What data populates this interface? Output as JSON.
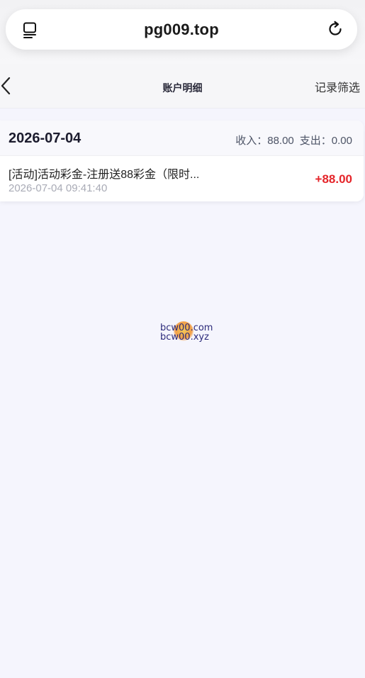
{
  "browser": {
    "url": "pg009.top",
    "icons": {
      "tabs": "tabs-icon",
      "reload": "reload-icon"
    }
  },
  "nav": {
    "back_icon": "chevron-left-icon",
    "title": "账户明细",
    "filter_label": "记录筛选"
  },
  "records": [
    {
      "date": "2026-07-04",
      "income_label": "收入：",
      "income_value": "88.00",
      "expense_label": "支出：",
      "expense_value": "0.00",
      "items": [
        {
          "title": "[活动]活动彩金-注册送88彩金（限时...",
          "time": "2026-07-04 09:41:40",
          "amount": "+88.00"
        }
      ]
    }
  ],
  "watermark": {
    "line1": "bcw00.com",
    "line2": "bcw00.xyz"
  },
  "colors": {
    "background": "#f5f5fd",
    "amount_positive": "#e5252a",
    "muted_text": "#a9abb6"
  }
}
